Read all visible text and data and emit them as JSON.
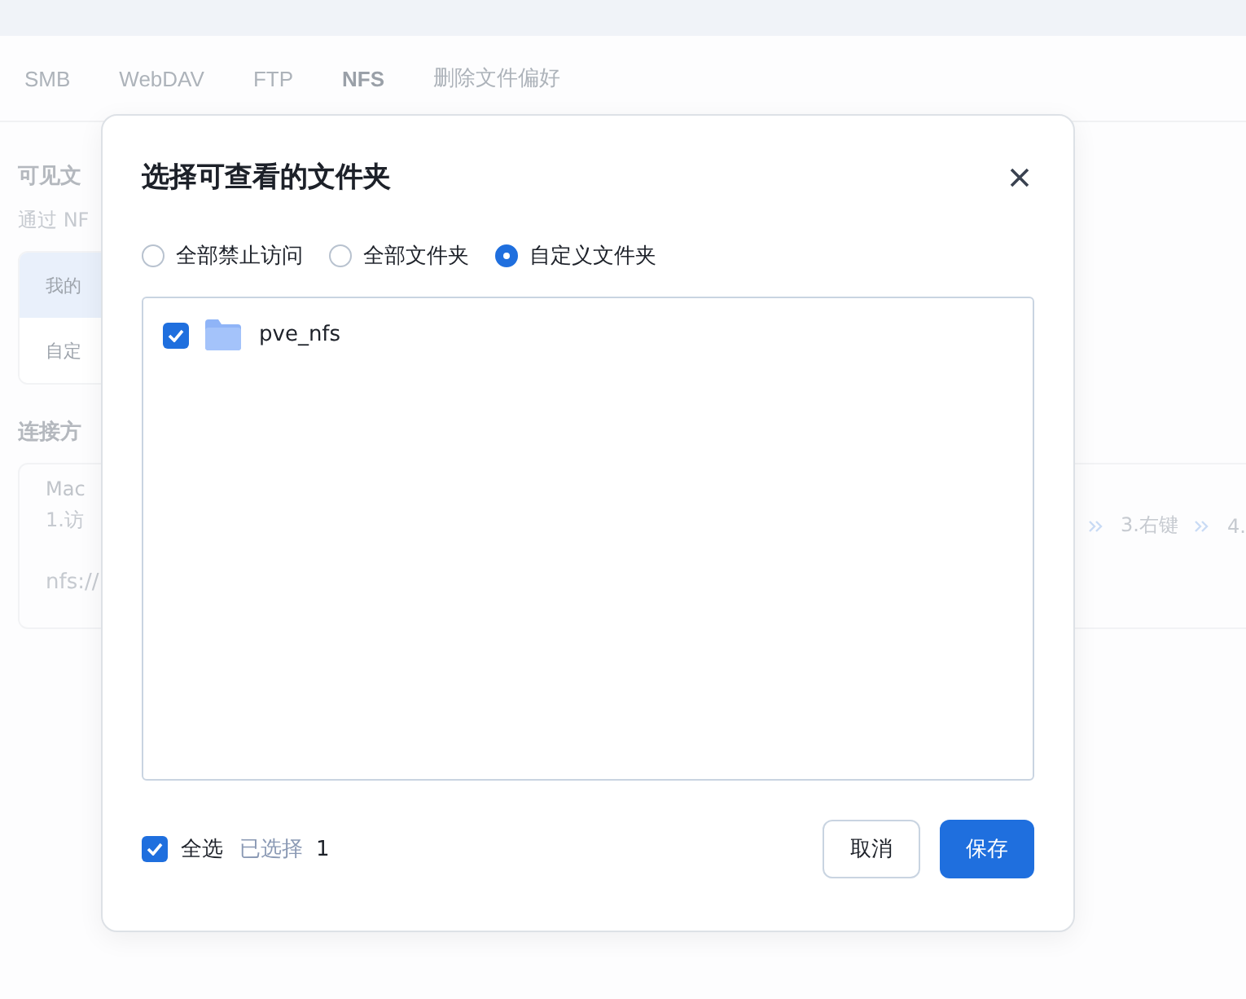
{
  "top_tabs": [
    {
      "label": "SMB",
      "selected": false
    },
    {
      "label": "WebDAV",
      "selected": false
    },
    {
      "label": "FTP",
      "selected": false
    },
    {
      "label": "NFS",
      "selected": true
    },
    {
      "label": "删除文件偏好",
      "selected": false
    }
  ],
  "page": {
    "section_title": "可见文",
    "description": "通过 NF",
    "folder_rows": [
      {
        "label": "我的",
        "selected": true
      },
      {
        "label": "自定",
        "selected": false
      }
    ],
    "connection_title": "连接方",
    "connection_card": {
      "platform": "Mac",
      "step": "1.访",
      "address": "nfs://",
      "steps": [
        "3.右键",
        "4."
      ]
    }
  },
  "dialog": {
    "title": "选择可查看的文件夹",
    "access_options": [
      {
        "label": "全部禁止访问",
        "selected": false
      },
      {
        "label": "全部文件夹",
        "selected": false
      },
      {
        "label": "自定义文件夹",
        "selected": true
      }
    ],
    "folders": [
      {
        "name": "pve_nfs",
        "checked": true
      }
    ],
    "select_all": {
      "label": "全选",
      "checked": true
    },
    "selected_label": "已选择",
    "selected_count": "1",
    "buttons": [
      {
        "label": "取消",
        "kind": "secondary"
      },
      {
        "label": "保存",
        "kind": "primary"
      }
    ]
  }
}
